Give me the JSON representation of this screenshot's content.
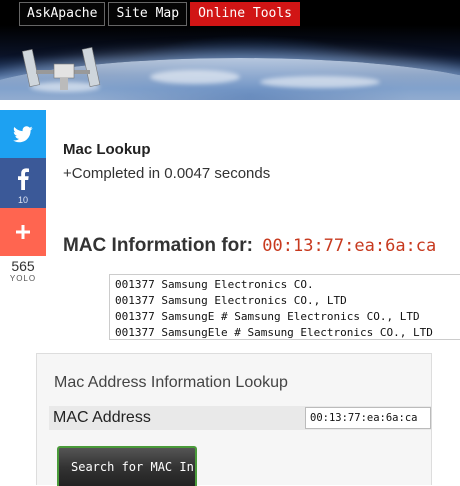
{
  "nav": {
    "items": [
      {
        "label": "AskApache"
      },
      {
        "label": "Site Map"
      },
      {
        "label": "Online Tools"
      }
    ]
  },
  "share": {
    "twitter_icon": "twitter-icon",
    "facebook_icon": "facebook-icon",
    "facebook_count": "10",
    "plus_icon": "plus-icon",
    "total": "565",
    "total_label": "YOLO"
  },
  "main": {
    "title": "Mac Lookup",
    "completed": "+Completed in 0.0047 seconds",
    "mac_info_label": "MAC Information for:",
    "mac_address": "00:13:77:ea:6a:ca",
    "results": [
      "001377 Samsung Electronics CO.",
      "001377 Samsung Electronics CO., LTD",
      "001377 SamsungE # Samsung Electronics CO., LTD",
      "001377 SamsungEle # Samsung Electronics CO., LTD"
    ]
  },
  "form": {
    "title": "Mac Address Information Lookup",
    "field_label": "MAC Address",
    "field_value": "00:13:77:ea:6a:ca",
    "button_label": "Search for MAC Info"
  },
  "colors": {
    "nav_active": "#d11515",
    "twitter": "#1da1f2",
    "facebook": "#3b5998",
    "plus": "#ff6550",
    "mac_address": "#c7391e",
    "button_border": "#4a9b3a"
  }
}
